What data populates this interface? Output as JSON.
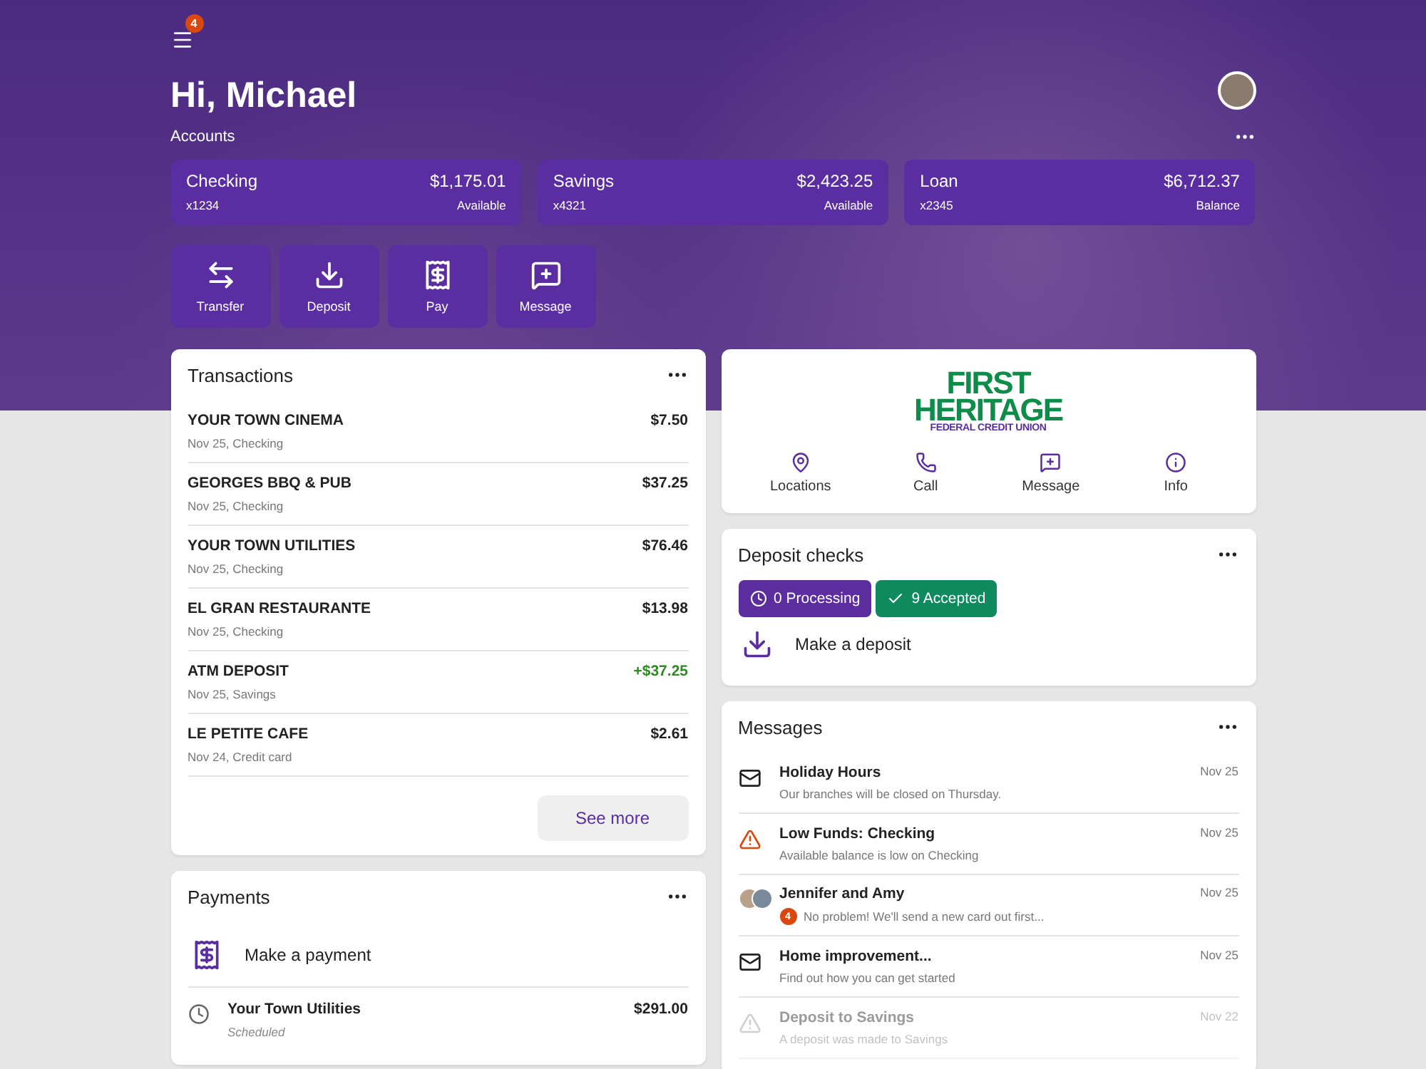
{
  "header": {
    "menu_badge": "4",
    "greeting": "Hi, Michael",
    "accounts_label": "Accounts"
  },
  "accounts": [
    {
      "name": "Checking",
      "number": "x1234",
      "amount": "$1,175.01",
      "caption": "Available"
    },
    {
      "name": "Savings",
      "number": "x4321",
      "amount": "$2,423.25",
      "caption": "Available"
    },
    {
      "name": "Loan",
      "number": "x2345",
      "amount": "$6,712.37",
      "caption": "Balance"
    }
  ],
  "actions": [
    {
      "kind": "transfer",
      "label": "Transfer"
    },
    {
      "kind": "deposit",
      "label": "Deposit"
    },
    {
      "kind": "pay",
      "label": "Pay"
    },
    {
      "kind": "message",
      "label": "Message"
    }
  ],
  "transactions": {
    "title": "Transactions",
    "rows": [
      {
        "name": "YOUR TOWN CINEMA",
        "detail": "Nov 25, Checking",
        "amount": "$7.50",
        "credit": false
      },
      {
        "name": "GEORGES BBQ & PUB",
        "detail": "Nov 25, Checking",
        "amount": "$37.25",
        "credit": false
      },
      {
        "name": "YOUR TOWN UTILITIES",
        "detail": "Nov 25, Checking",
        "amount": "$76.46",
        "credit": false
      },
      {
        "name": "EL GRAN RESTAURANTE",
        "detail": "Nov 25, Checking",
        "amount": "$13.98",
        "credit": false
      },
      {
        "name": "ATM DEPOSIT",
        "detail": "Nov 25, Savings",
        "amount": "+$37.25",
        "credit": true
      },
      {
        "name": "LE PETITE CAFE",
        "detail": "Nov 24, Credit card",
        "amount": "$2.61",
        "credit": false
      }
    ],
    "see_more": "See more"
  },
  "payments": {
    "title": "Payments",
    "make": "Make a payment",
    "rows": [
      {
        "name": "Your Town Utilities",
        "status": "Scheduled",
        "amount": "$291.00"
      }
    ]
  },
  "brand": {
    "logo_lines": [
      "FIRST",
      "HERITAGE",
      "FEDERAL CREDIT UNION"
    ],
    "links": [
      {
        "kind": "location",
        "label": "Locations"
      },
      {
        "kind": "call",
        "label": "Call"
      },
      {
        "kind": "message",
        "label": "Message"
      },
      {
        "kind": "info",
        "label": "Info"
      }
    ]
  },
  "deposit_checks": {
    "title": "Deposit checks",
    "statuses": [
      {
        "kind": "processing",
        "label": "0 Processing",
        "color": "#5b2d9e"
      },
      {
        "kind": "accepted",
        "label": "9 Accepted",
        "color": "#0f8a5f"
      }
    ],
    "make": "Make a deposit"
  },
  "messages": {
    "title": "Messages",
    "items": [
      {
        "kind": "mail",
        "title": "Holiday Hours",
        "preview": "Our branches will be closed on Thursday.",
        "date": "Nov 25",
        "dimmed": false
      },
      {
        "kind": "alert",
        "title": "Low Funds: Checking",
        "preview": "Available balance is low on Checking",
        "date": "Nov 25",
        "dimmed": false
      },
      {
        "kind": "people",
        "title": "Jennifer and Amy",
        "preview": "No problem! We'll send a new card out first...",
        "badge": "4",
        "date": "Nov 25",
        "dimmed": false
      },
      {
        "kind": "mail",
        "title": "Home improvement...",
        "preview": "Find out how you can get started",
        "date": "Nov 25",
        "dimmed": false
      },
      {
        "kind": "alert",
        "title": "Deposit to Savings",
        "preview": "A deposit was made to Savings",
        "date": "Nov 22",
        "dimmed": true
      }
    ]
  }
}
